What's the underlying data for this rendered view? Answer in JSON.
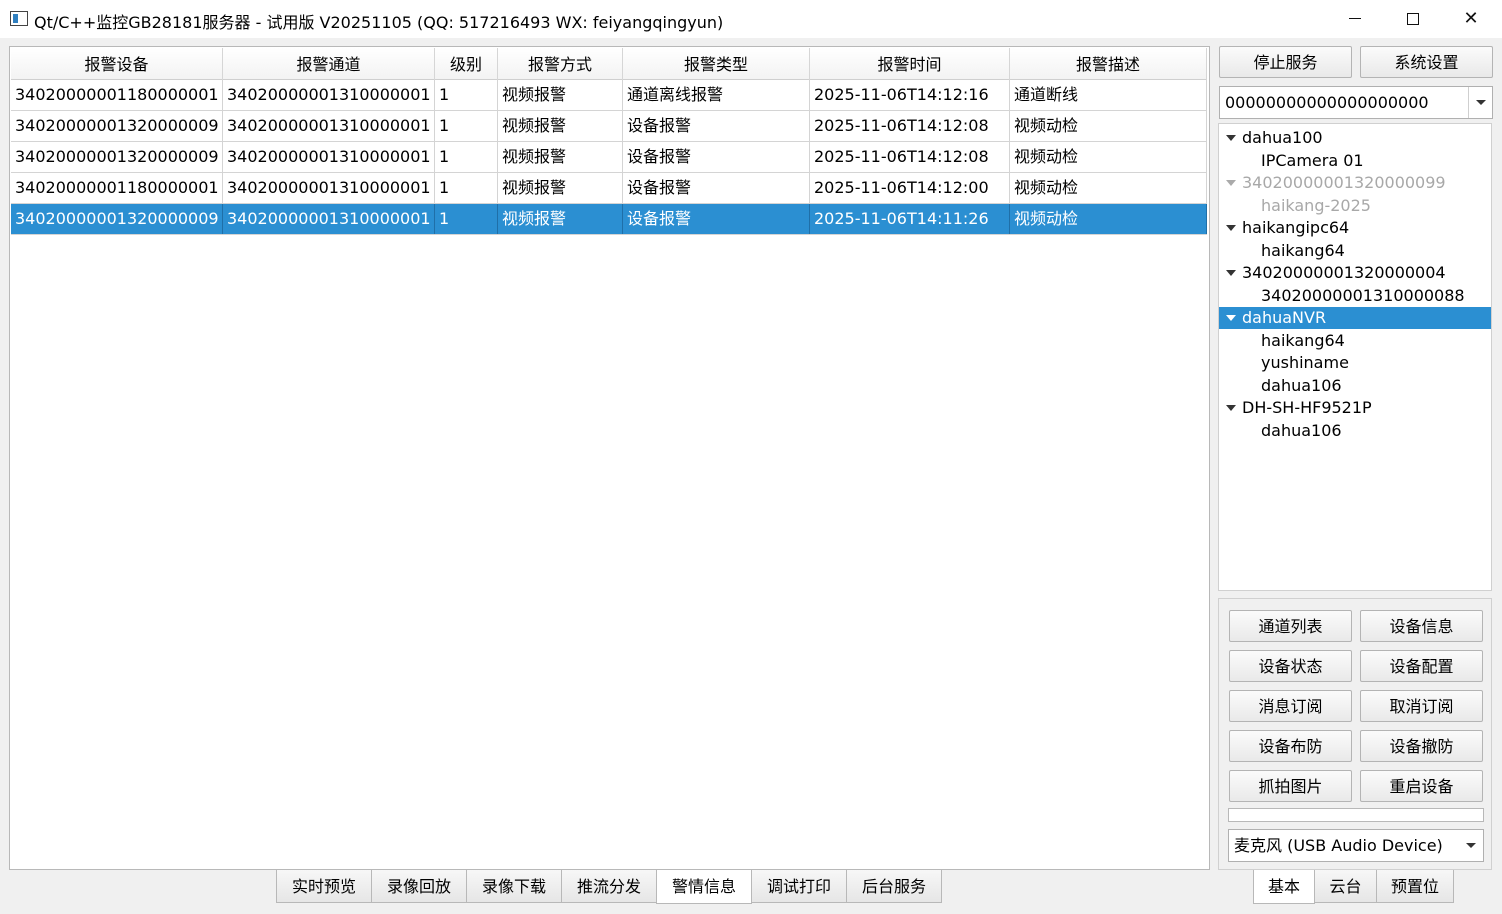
{
  "window": {
    "title": "Qt/C++监控GB28181服务器 - 试用版 V20251105 (QQ: 517216493 WX: feiyangqingyun)"
  },
  "alarm_table": {
    "columns": [
      "报警设备",
      "报警通道",
      "级别",
      "报警方式",
      "报警类型",
      "报警时间",
      "报警描述"
    ],
    "rows": [
      [
        "34020000001180000001",
        "34020000001310000001",
        "1",
        "视频报警",
        "通道离线报警",
        "2025-11-06T14:12:16",
        "通道断线"
      ],
      [
        "34020000001320000009",
        "34020000001310000001",
        "1",
        "视频报警",
        "设备报警",
        "2025-11-06T14:12:08",
        "视频动检"
      ],
      [
        "34020000001320000009",
        "34020000001310000001",
        "1",
        "视频报警",
        "设备报警",
        "2025-11-06T14:12:08",
        "视频动检"
      ],
      [
        "34020000001180000001",
        "34020000001310000001",
        "1",
        "视频报警",
        "设备报警",
        "2025-11-06T14:12:00",
        "视频动检"
      ],
      [
        "34020000001320000009",
        "34020000001310000001",
        "1",
        "视频报警",
        "设备报警",
        "2025-11-06T14:11:26",
        "视频动检"
      ]
    ],
    "selected_row": 4
  },
  "side": {
    "stop_service": "停止服务",
    "system_settings": "系统设置",
    "device_combo_value": "00000000000000000000",
    "tree": [
      {
        "label": "dahua100",
        "level": 0,
        "expanded": true
      },
      {
        "label": "IPCamera 01",
        "level": 1
      },
      {
        "label": "34020000001320000099",
        "level": 0,
        "expanded": true,
        "dim": true
      },
      {
        "label": "haikang-2025",
        "level": 1,
        "dim": true
      },
      {
        "label": "haikangipc64",
        "level": 0,
        "expanded": true
      },
      {
        "label": "haikang64",
        "level": 1
      },
      {
        "label": "34020000001320000004",
        "level": 0,
        "expanded": true
      },
      {
        "label": "34020000001310000088",
        "level": 1
      },
      {
        "label": "dahuaNVR",
        "level": 0,
        "expanded": true,
        "selected": true
      },
      {
        "label": "haikang64",
        "level": 1
      },
      {
        "label": "yushiname",
        "level": 1
      },
      {
        "label": "dahua106",
        "level": 1
      },
      {
        "label": "DH-SH-HF9521P",
        "level": 0,
        "expanded": true
      },
      {
        "label": "dahua106",
        "level": 1
      }
    ],
    "actions": [
      [
        "通道列表",
        "设备信息"
      ],
      [
        "设备状态",
        "设备配置"
      ],
      [
        "消息订阅",
        "取消订阅"
      ],
      [
        "设备布防",
        "设备撤防"
      ],
      [
        "抓拍图片",
        "重启设备"
      ]
    ],
    "progress": 0,
    "audio_device": "麦克风 (USB Audio Device)",
    "tabs": [
      "基本",
      "云台",
      "预置位"
    ],
    "active_tab": 0
  },
  "main_tabs": {
    "items": [
      "实时预览",
      "录像回放",
      "录像下载",
      "推流分发",
      "警情信息",
      "调试打印",
      "后台服务"
    ],
    "active": 4
  },
  "colors": {
    "selection": "#2b8fd2",
    "dimmed_text": "#a8a8a8"
  }
}
